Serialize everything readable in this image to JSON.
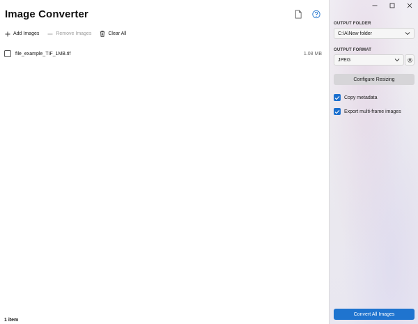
{
  "app": {
    "title": "Image Converter"
  },
  "title_icons": [
    {
      "name": "document-icon"
    },
    {
      "name": "help-icon"
    }
  ],
  "toolbar": {
    "add_label": "Add Images",
    "remove_label": "Remove Images",
    "clear_label": "Clear All"
  },
  "files": [
    {
      "name": "file_example_TIF_1MB.tif",
      "size": "1.08 MB",
      "checked": false
    }
  ],
  "status": {
    "count_text": "1 item"
  },
  "window_controls": [
    "minimize-icon",
    "maximize-icon",
    "close-icon"
  ],
  "pane": {
    "output_folder_label": "OUTPUT FOLDER",
    "output_folder_value": "C:\\A\\New folder",
    "output_format_label": "OUTPUT FORMAT",
    "output_format_value": "JPEG",
    "configure_resizing_label": "Configure Resizing",
    "copy_metadata_label": "Copy metadata",
    "copy_metadata_checked": true,
    "export_multiframe_label": "Export multi-frame images",
    "export_multiframe_checked": true,
    "convert_all_label": "Convert All Images"
  },
  "colors": {
    "accent": "#1f74cf",
    "checkbox_checked": "#1a6fce",
    "configure_button_bg": "#d6d5d8"
  }
}
